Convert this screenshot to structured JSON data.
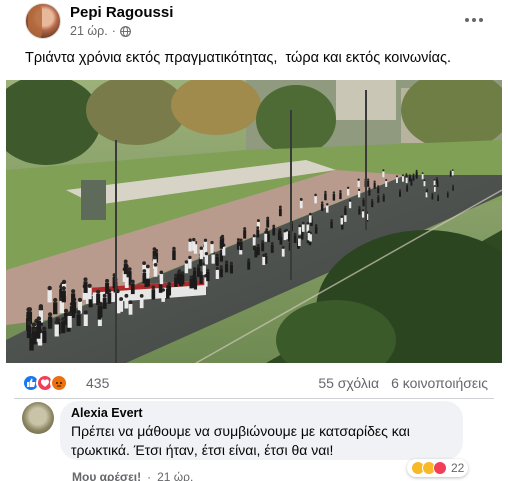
{
  "post": {
    "author": "Pepi Ragoussi",
    "time": "21 ώρ.",
    "text": "Τριάντα χρόνια εκτός πραγματικότητας,  τώρα και εκτός κοινωνίας.",
    "photo_banner_text": ""
  },
  "reactions": {
    "icons": [
      "like-icon",
      "love-icon",
      "angry-icon"
    ],
    "count": "435",
    "comments": "55 σχόλια",
    "shares": "6 κοινοποιήσεις"
  },
  "comment": {
    "author": "Alexia Evert",
    "text_line1": "Πρέπει να μάθουμε να συμβιώνουμε με κατσαρίδες και",
    "text_line2": "τρωκτικά. Έτσι ήταν, έτσι είναι, έτσι θα ναι!",
    "reaction_count": "22",
    "reaction_icons": [
      "haha-icon",
      "sad-icon",
      "love-icon"
    ],
    "action_like": "Μου αρέσει!",
    "separator": "·",
    "time": "21 ώρ."
  },
  "colors": {
    "primary_text": "#050505",
    "secondary_text": "#65676b",
    "like_blue": "#1877f2",
    "love_red": "#f33e58",
    "angry_orange": "#e9710f",
    "bubble_bg": "#f0f2f5"
  }
}
